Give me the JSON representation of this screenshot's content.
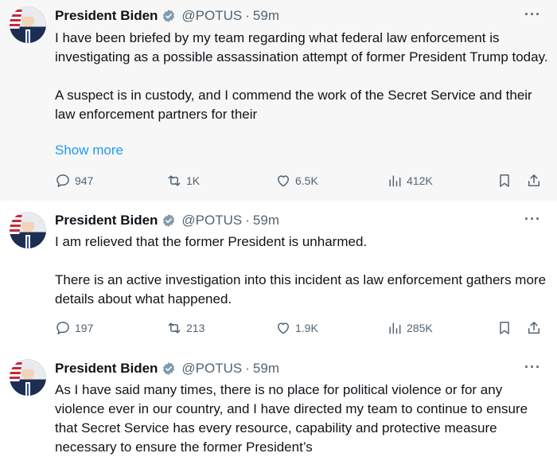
{
  "tweets": [
    {
      "author": "President Biden",
      "handle": "@POTUS",
      "separator": "·",
      "time": "59m",
      "more": "···",
      "paragraphs": [
        "I have been briefed by my team regarding what federal law enforcement is investigating as a possible assassination attempt of former President Trump today.",
        "A suspect is in custody, and I commend the work of the Secret Service and their law enforcement partners for their"
      ],
      "show_more": "Show more",
      "replies": "947",
      "reposts": "1K",
      "likes": "6.5K",
      "views": "412K"
    },
    {
      "author": "President Biden",
      "handle": "@POTUS",
      "separator": "·",
      "time": "59m",
      "more": "···",
      "paragraphs": [
        "I am relieved that the former President is unharmed.",
        "There is an active investigation into this incident as law enforcement gathers more details about what happened."
      ],
      "replies": "197",
      "reposts": "213",
      "likes": "1.9K",
      "views": "285K"
    },
    {
      "author": "President Biden",
      "handle": "@POTUS",
      "separator": "·",
      "time": "59m",
      "more": "···",
      "paragraphs": [
        "As I have said many times, there is no place for political violence or for any violence ever in our country, and I have directed my team to continue to ensure that Secret Service has every resource, capability and protective measure necessary to ensure the former President’s"
      ]
    }
  ],
  "icons": {
    "verified": "verified-badge-icon",
    "reply": "reply-icon",
    "repost": "repost-icon",
    "like": "heart-icon",
    "views": "views-icon",
    "bookmark": "bookmark-icon",
    "share": "share-icon",
    "more": "more-icon"
  },
  "colors": {
    "link": "#1d9bf0",
    "muted": "#536471",
    "text": "#0f1419",
    "highlight_bg": "#f7f7f7",
    "verified_badge": "#829aab"
  }
}
